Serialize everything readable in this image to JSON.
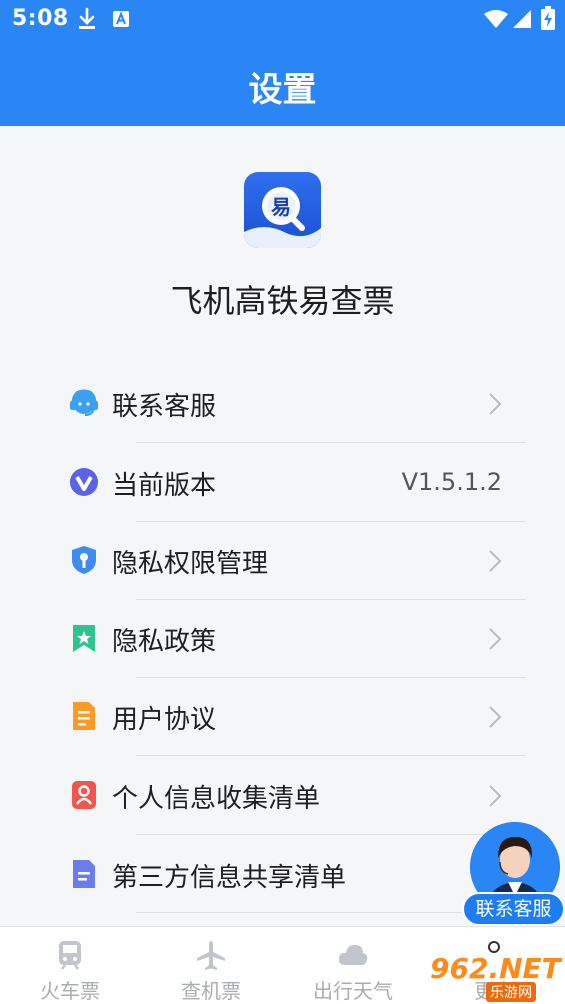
{
  "status_bar": {
    "time": "5:08"
  },
  "header": {
    "title": "设置"
  },
  "app": {
    "name": "飞机高铁易查票",
    "logo_glyph": "易"
  },
  "menu": [
    {
      "label": "联系客服",
      "icon": "headset-icon",
      "has_arrow": true
    },
    {
      "label": "当前版本",
      "icon": "version-icon",
      "value": "V1.5.1.2",
      "has_arrow": false
    },
    {
      "label": "隐私权限管理",
      "icon": "shield-key-icon",
      "has_arrow": true
    },
    {
      "label": "隐私政策",
      "icon": "bookmark-star-icon",
      "has_arrow": true
    },
    {
      "label": "用户协议",
      "icon": "document-icon",
      "has_arrow": true
    },
    {
      "label": "个人信息收集清单",
      "icon": "person-card-icon",
      "has_arrow": true
    },
    {
      "label": "第三方信息共享清单",
      "icon": "list-document-icon",
      "has_arrow": true
    }
  ],
  "bottom_nav": [
    {
      "label": "火车票",
      "icon": "train-icon"
    },
    {
      "label": "查机票",
      "icon": "airplane-icon"
    },
    {
      "label": "出行天气",
      "icon": "cloud-icon"
    },
    {
      "label": "更多",
      "icon": "more-icon"
    }
  ],
  "floating_service": {
    "label": "联系客服"
  },
  "watermark": {
    "text": "962.NET",
    "subtext": "乐游网"
  },
  "colors": {
    "header": "#2a86f5",
    "background": "#f5f6f8",
    "nav_inactive": "#a9acb2"
  }
}
